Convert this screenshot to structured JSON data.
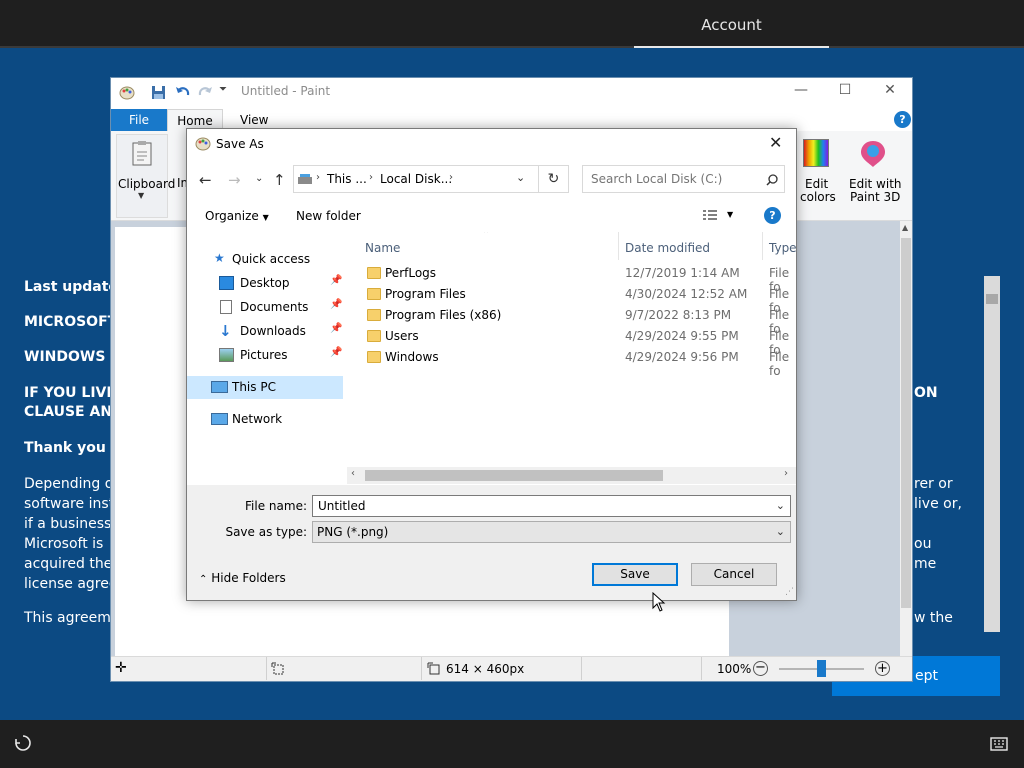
{
  "oobe": {
    "tab": "Account",
    "accept_label": "ept",
    "license_lines": [
      {
        "text": "Last updated",
        "bold": true
      },
      {
        "text": "MICROSOFT",
        "bold": true
      },
      {
        "text": "WINDOWS C",
        "bold": true
      },
      {
        "text": "IF YOU LIVE",
        "bold": true
      },
      {
        "text": "CLAUSE AND",
        "bold": true
      },
      {
        "text": "Thank you fo",
        "bold": true
      },
      {
        "text": "Depending o",
        "bold": false
      },
      {
        "text": "software inst",
        "bold": false
      },
      {
        "text": "if a business",
        "bold": false
      },
      {
        "text": "Microsoft is",
        "bold": false
      },
      {
        "text": "acquired the",
        "bold": false
      },
      {
        "text": "license agree",
        "bold": false
      },
      {
        "text": "This agreeme",
        "bold": false
      }
    ],
    "license_right": [
      "ON",
      "rer or",
      "live or,",
      "ou",
      "me",
      "w the"
    ]
  },
  "paint": {
    "title": "Untitled - Paint",
    "tabs": {
      "file": "File",
      "home": "Home",
      "view": "View"
    },
    "ribbon": {
      "clipboard": "Clipboard",
      "image_partial": "Im",
      "edit_colors_1": "Edit",
      "edit_colors_2": "colors",
      "paint3d_1": "Edit with",
      "paint3d_2": "Paint 3D"
    },
    "status": {
      "size": "614 × 460px",
      "zoom": "100%"
    },
    "zoom_fraction": 0.5
  },
  "dialog": {
    "title": "Save As",
    "address": {
      "seg1": "This ...",
      "seg2": "Local Disk..."
    },
    "search_placeholder": "Search Local Disk (C:)",
    "organize": "Organize",
    "new_folder": "New folder",
    "nav": {
      "quick_access": "Quick access",
      "desktop": "Desktop",
      "documents": "Documents",
      "downloads": "Downloads",
      "pictures": "Pictures",
      "this_pc": "This PC",
      "network": "Network"
    },
    "columns": {
      "name": "Name",
      "date": "Date modified",
      "type": "Type"
    },
    "files": [
      {
        "name": "PerfLogs",
        "date": "12/7/2019 1:14 AM",
        "type": "File fo"
      },
      {
        "name": "Program Files",
        "date": "4/30/2024 12:52 AM",
        "type": "File fo"
      },
      {
        "name": "Program Files (x86)",
        "date": "9/7/2022 8:13 PM",
        "type": "File fo"
      },
      {
        "name": "Users",
        "date": "4/29/2024 9:55 PM",
        "type": "File fo"
      },
      {
        "name": "Windows",
        "date": "4/29/2024 9:56 PM",
        "type": "File fo"
      }
    ],
    "file_name_label": "File name:",
    "file_name_value": "Untitled",
    "save_type_label": "Save as type:",
    "save_type_value": "PNG (*.png)",
    "hide_folders": "Hide Folders",
    "save": "Save",
    "cancel": "Cancel"
  }
}
